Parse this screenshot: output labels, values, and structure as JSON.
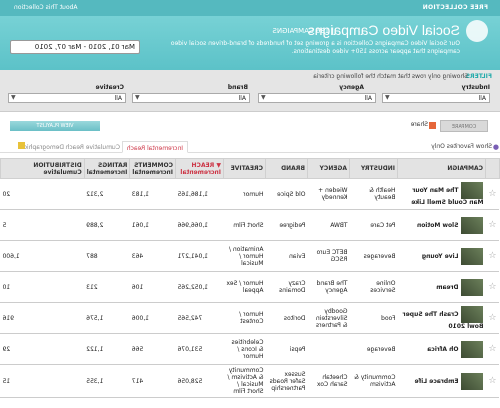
{
  "header": {
    "section_label": "FREE COLLECTION",
    "about_link": "About This Collection",
    "title": "Social Video Campaigns",
    "count": "| 136 CAMPAIGNS",
    "description": "Our Social Video Campaigns Collection is a growing set of hundreds of brand-driven social video campaigns that appear across 150+ video destinations.",
    "date_range": "Mar 01, 2010 - Mar 07, 2010"
  },
  "filters": {
    "title": "FILTERS",
    "note": "Showing only rows that match the following criteria",
    "fields": [
      {
        "label": "Industry",
        "value": "All"
      },
      {
        "label": "Agency",
        "value": "All"
      },
      {
        "label": "Brand",
        "value": "All"
      },
      {
        "label": "Creative",
        "value": "All"
      }
    ]
  },
  "toolbar": {
    "compare": "COMPARE",
    "share": "Share",
    "view_playlist": "VIEW PLAYLIST"
  },
  "tabs": {
    "show_favorites": "Show Favorites Only",
    "items": [
      "Incremental Reach",
      "Cumulative Reach",
      "Demographics"
    ]
  },
  "table": {
    "headers": {
      "campaign": "CAMPAIGN",
      "industry": "INDUSTRY",
      "agency": "AGENCY",
      "brand": "BRAND",
      "creative": "CREATIVE",
      "reach": "▼ REACH Incremental",
      "comments": "COMMENTS Incremental",
      "ratings": "RATINGS Incremental",
      "distribution": "DISTRIBUTION Cumulative"
    },
    "rows": [
      {
        "campaign": "The Man Your Man Could Smell Like",
        "industry": "Health & Beauty",
        "agency": "Wieden + Kennedy",
        "brand": "Old Spice",
        "creative": "Humor",
        "reach": "1,186,165",
        "comments": "1,183",
        "ratings": "2,312",
        "distribution": "20"
      },
      {
        "campaign": "Slow Motion",
        "industry": "Pet Care",
        "agency": "TBWA",
        "brand": "Pedigree",
        "creative": "Short Film",
        "reach": "1,066,966",
        "comments": "1,061",
        "ratings": "2,889",
        "distribution": "5"
      },
      {
        "campaign": "Live Young",
        "industry": "Beverages",
        "agency": "BETC Euro RSCG",
        "brand": "Evian",
        "creative": "Animation / Humor / Musical",
        "reach": "1,041,271",
        "comments": "463",
        "ratings": "887",
        "distribution": "1,600"
      },
      {
        "campaign": "Dream",
        "industry": "Online Services",
        "agency": "The Brand Agency",
        "brand": "Crazy Domains",
        "creative": "Humor / Sex Appeal",
        "reach": "1,052,265",
        "comments": "106",
        "ratings": "213",
        "distribution": "10"
      },
      {
        "campaign": "Crash The Super Bowl 2010",
        "industry": "Food",
        "agency": "Goodby Silverstein & Partners",
        "brand": "Doritos",
        "creative": "Humor / Contest",
        "reach": "742,565",
        "comments": "1,006",
        "ratings": "1,576",
        "distribution": "916"
      },
      {
        "campaign": "Oh Africa",
        "industry": "Beverage",
        "agency": "",
        "brand": "Pepsi",
        "creative": "Celebrities & Icons / Humor",
        "reach": "531,076",
        "comments": "566",
        "ratings": "1,122",
        "distribution": "29"
      },
      {
        "campaign": "Embrace Life",
        "industry": "Community & Activism",
        "agency": "Cheetah Sarah Cox",
        "brand": "Sussex Safer Roads Partnership",
        "creative": "Community & Activism / Musical / Short Film",
        "reach": "528,056",
        "comments": "417",
        "ratings": "1,355",
        "distribution": "15"
      }
    ]
  }
}
